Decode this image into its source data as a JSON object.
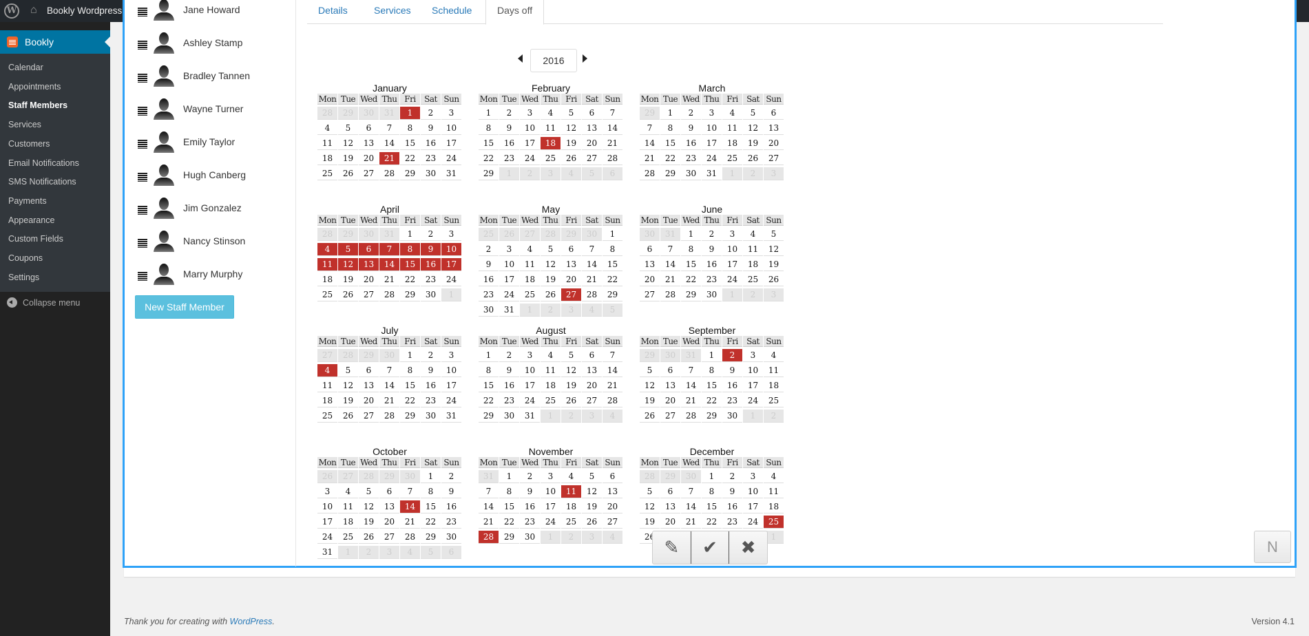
{
  "adminbar": {
    "site_name": "Bookly Wordpress"
  },
  "sidebar": {
    "plugin_label": "Bookly",
    "items": [
      "Calendar",
      "Appointments",
      "Staff Members",
      "Services",
      "Customers",
      "Email Notifications",
      "SMS Notifications",
      "Payments",
      "Appearance",
      "Custom Fields",
      "Coupons",
      "Settings"
    ],
    "current": "Staff Members",
    "collapse_label": "Collapse menu"
  },
  "staff": {
    "members": [
      "Jane Howard",
      "Ashley Stamp",
      "Bradley Tannen",
      "Wayne Turner",
      "Emily Taylor",
      "Hugh Canberg",
      "Jim Gonzalez",
      "Nancy Stinson",
      "Marry Murphy"
    ],
    "new_button": "New Staff Member"
  },
  "tabs": [
    {
      "label": "Details"
    },
    {
      "label": "Services"
    },
    {
      "label": "Schedule"
    },
    {
      "label": "Days off",
      "active": true
    }
  ],
  "calendar": {
    "year": "2016",
    "weekdays": [
      "Mon",
      "Tue",
      "Wed",
      "Thu",
      "Fri",
      "Sat",
      "Sun"
    ],
    "off_color": "#c0312b",
    "months": [
      {
        "name": "January",
        "lead": [
          28,
          29,
          30,
          31
        ],
        "days": 31,
        "trail": [],
        "off": [
          1,
          21
        ]
      },
      {
        "name": "February",
        "lead": [],
        "days": 29,
        "trail": [
          1,
          2,
          3,
          4,
          5,
          6
        ],
        "off": [
          18
        ]
      },
      {
        "name": "March",
        "lead": [
          29
        ],
        "days": 31,
        "trail": [
          1,
          2,
          3
        ],
        "off": []
      },
      {
        "name": "April",
        "lead": [
          28,
          29,
          30,
          31
        ],
        "days": 30,
        "trail": [
          1
        ],
        "off": [
          4,
          5,
          6,
          7,
          8,
          9,
          10,
          11,
          12,
          13,
          14,
          15,
          16,
          17
        ]
      },
      {
        "name": "May",
        "lead": [
          25,
          26,
          27,
          28,
          29,
          30
        ],
        "days": 31,
        "trail": [
          1,
          2,
          3,
          4,
          5
        ],
        "off": [
          27
        ]
      },
      {
        "name": "June",
        "lead": [
          30,
          31
        ],
        "days": 30,
        "trail": [
          1,
          2,
          3
        ],
        "off": []
      },
      {
        "name": "July",
        "lead": [
          27,
          28,
          29,
          30
        ],
        "days": 31,
        "trail": [],
        "off": [
          4
        ]
      },
      {
        "name": "August",
        "lead": [],
        "days": 31,
        "trail": [
          1,
          2,
          3,
          4
        ],
        "off": []
      },
      {
        "name": "September",
        "lead": [
          29,
          30,
          31
        ],
        "days": 30,
        "trail": [
          1,
          2
        ],
        "off": [
          2
        ]
      },
      {
        "name": "October",
        "lead": [
          26,
          27,
          28,
          29,
          30
        ],
        "days": 31,
        "trail": [
          1,
          2,
          3,
          4,
          5,
          6
        ],
        "off": [
          14
        ]
      },
      {
        "name": "November",
        "lead": [
          31
        ],
        "days": 30,
        "trail": [
          1,
          2,
          3,
          4
        ],
        "off": [
          11,
          28
        ]
      },
      {
        "name": "December",
        "lead": [
          28,
          29,
          30
        ],
        "days": 31,
        "trail": [
          1
        ],
        "off": [
          25
        ]
      }
    ]
  },
  "footer": {
    "thanks": "Thank you for creating with ",
    "link": "WordPress",
    "period": ".",
    "version": "Version 4.1"
  },
  "actions": {
    "n_label": "N"
  }
}
